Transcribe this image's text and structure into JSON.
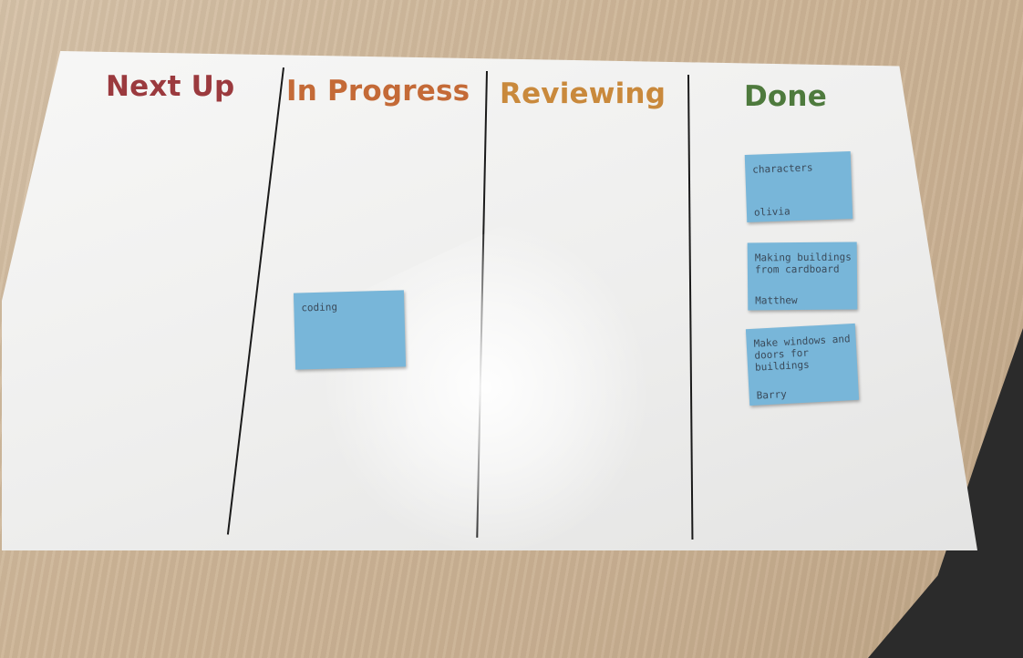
{
  "board": {
    "columns": [
      {
        "label": "Next Up",
        "color": "#9b3a3e"
      },
      {
        "label": "In Progress",
        "color": "#c46a37"
      },
      {
        "label": "Reviewing",
        "color": "#c9893c"
      },
      {
        "label": "Done",
        "color": "#4e7a3d"
      }
    ],
    "notes": {
      "coding": {
        "text": "coding"
      },
      "characters": {
        "text": "characters",
        "name": "olivia"
      },
      "buildings": {
        "text": "Making buildings from cardboard",
        "name": "Matthew"
      },
      "windows": {
        "text": "Make windows and doors for buildings",
        "name": "Barry"
      }
    },
    "note_color": "#78b6d9"
  }
}
